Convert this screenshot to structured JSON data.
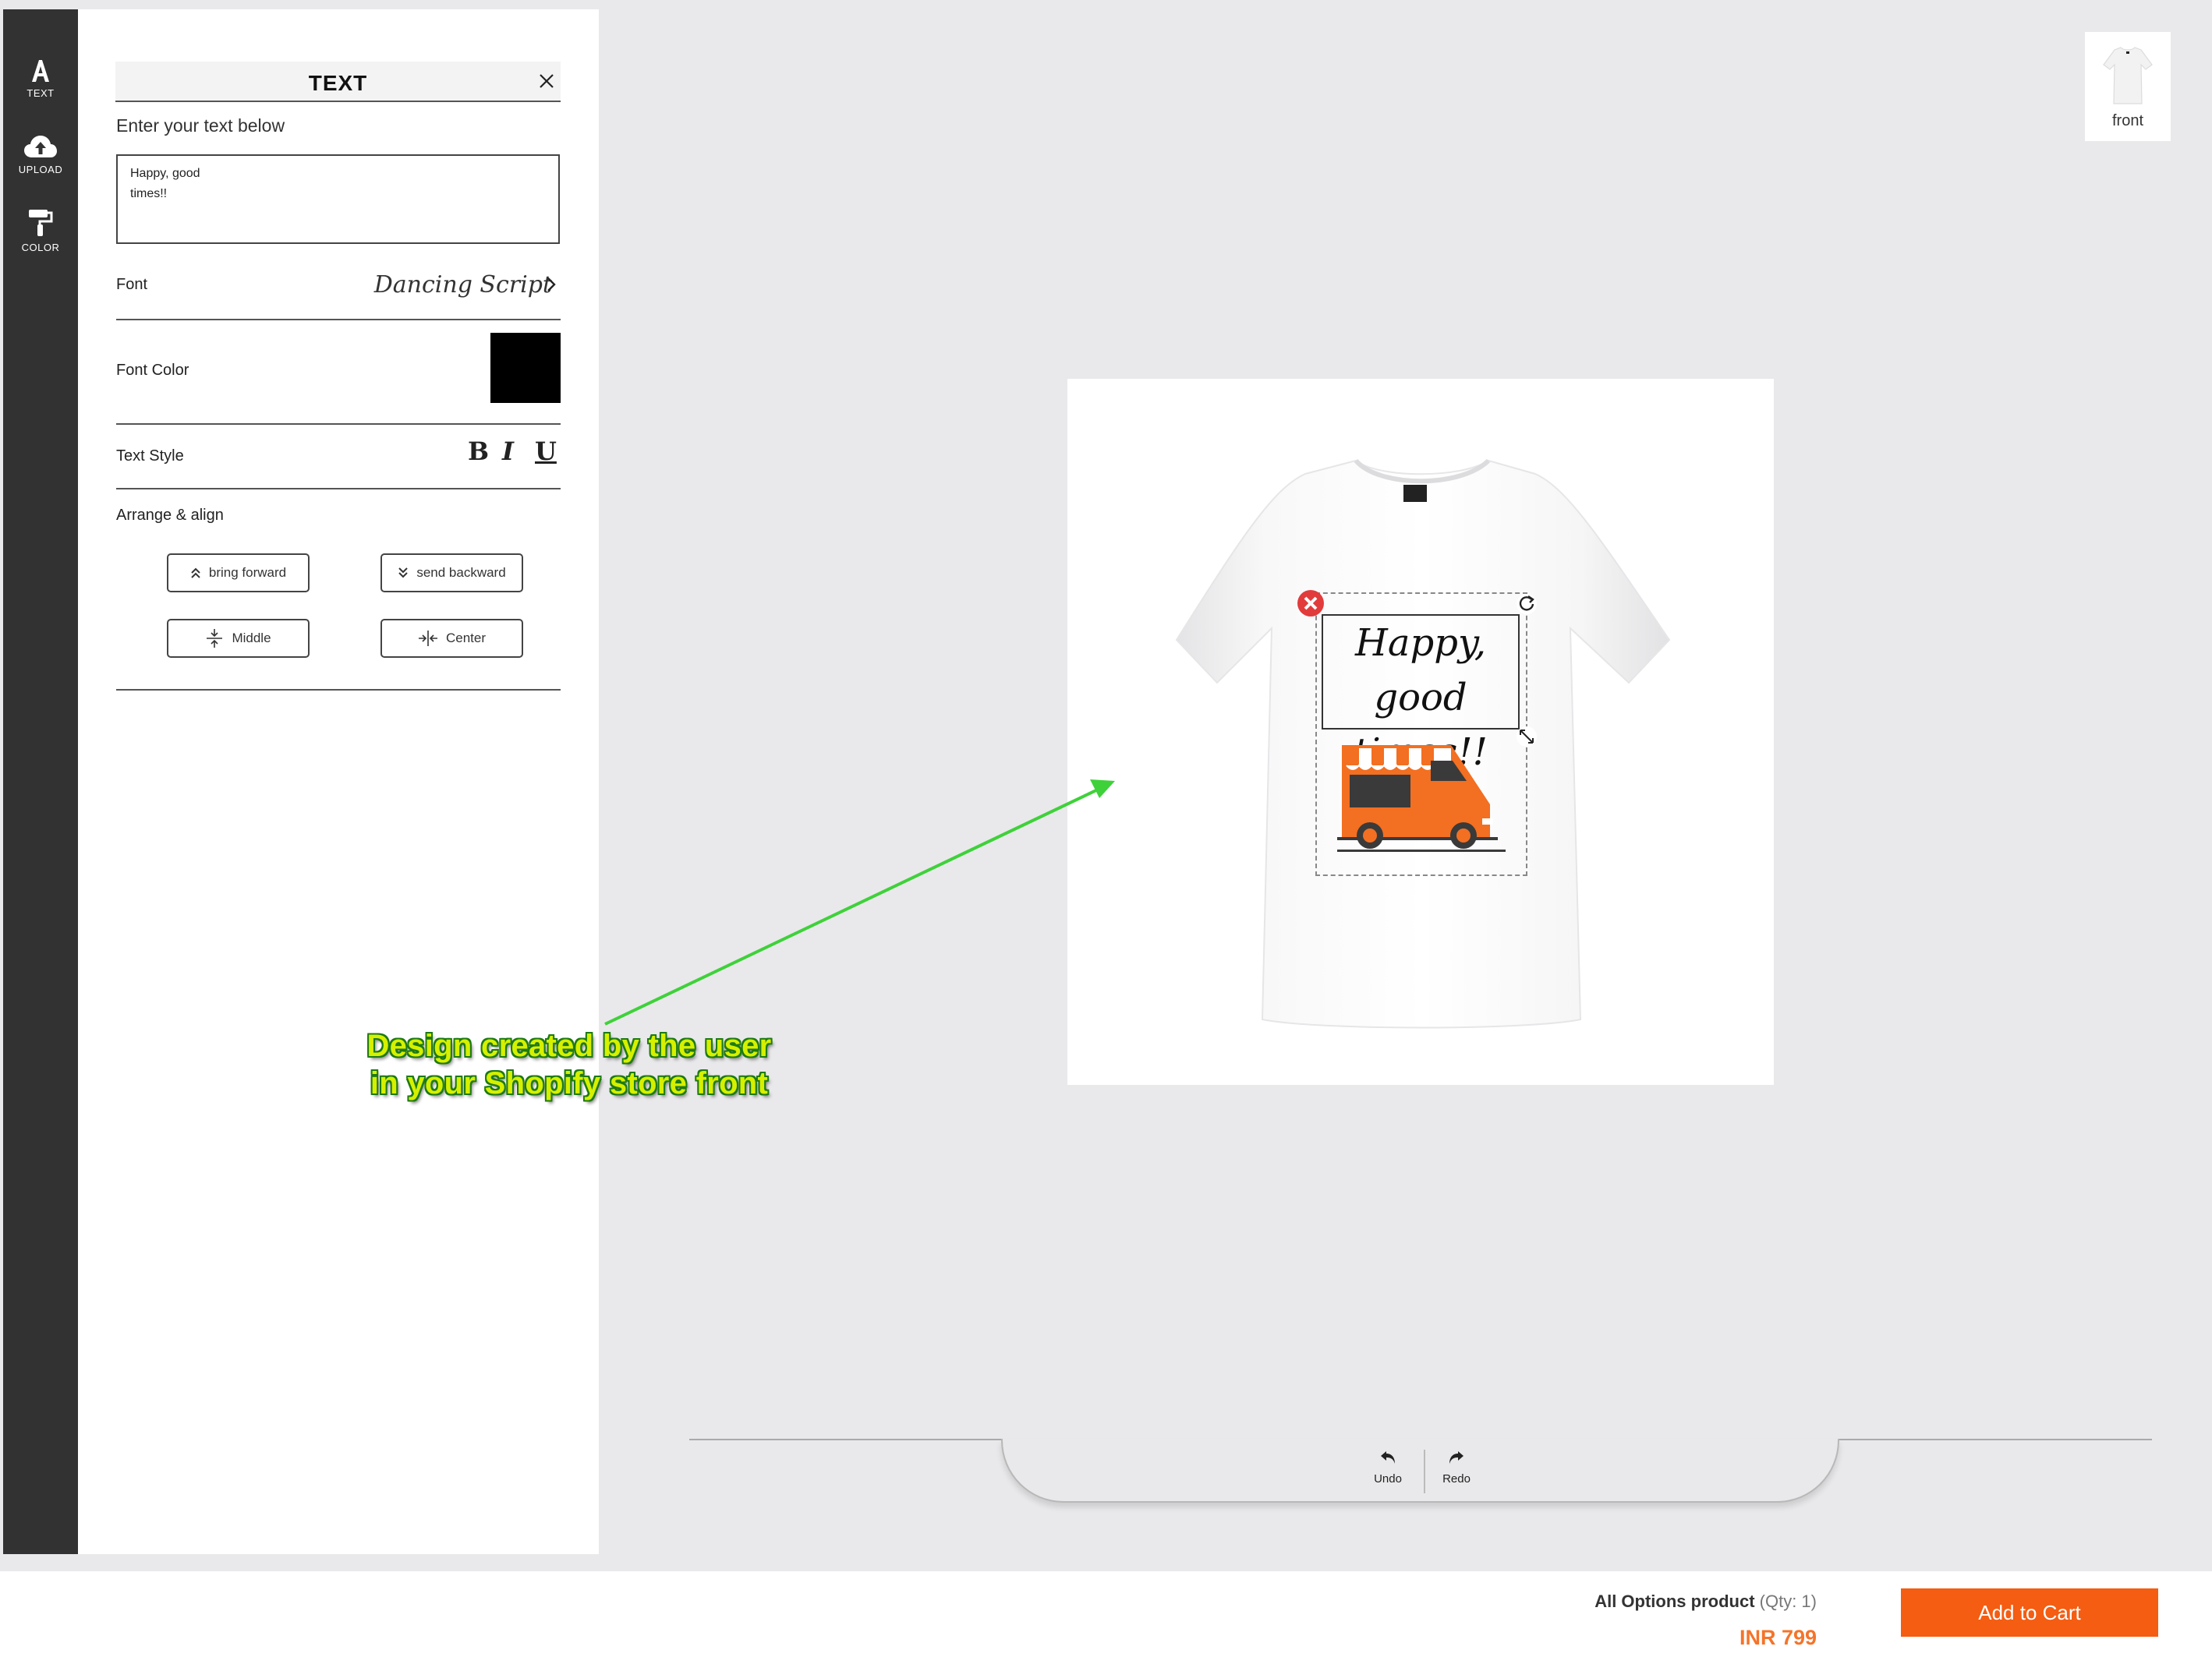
{
  "toolbar": {
    "items": [
      {
        "label": "TEXT",
        "icon": "text-icon"
      },
      {
        "label": "UPLOAD",
        "icon": "cloud-upload-icon"
      },
      {
        "label": "COLOR",
        "icon": "paint-roller-icon"
      }
    ]
  },
  "panel": {
    "title": "TEXT",
    "prompt": "Enter your text below",
    "text_value": "Happy, good\ntimes!!",
    "font_label": "Font",
    "font_value": "Dancing Script",
    "font_color_label": "Font Color",
    "font_color": "#000000",
    "text_style_label": "Text Style",
    "style_buttons": {
      "bold": "B",
      "italic": "I",
      "underline": "U"
    },
    "arrange_label": "Arrange & align",
    "arrange_buttons": {
      "bring_forward": "bring forward",
      "send_backward": "send backward",
      "middle": "Middle",
      "center": "Center"
    }
  },
  "canvas": {
    "design_text": "Happy, good times!!",
    "design_image": "food-truck-van",
    "product_color": "#ffffff"
  },
  "annotation": {
    "line1": "Design created by the user",
    "line2": "in your Shopify store front"
  },
  "views": [
    {
      "label": "front"
    }
  ],
  "history": {
    "undo": "Undo",
    "redo": "Redo"
  },
  "footer": {
    "product_name": "All Options product",
    "qty_text": "(Qty: 1)",
    "price": "INR 799",
    "add_to_cart": "Add to Cart"
  },
  "colors": {
    "accent": "#f45d12",
    "price": "#f4742a",
    "toolbar_bg": "#323232",
    "van_orange": "#f36f21",
    "annotation_fill": "#d6f000",
    "annotation_outline": "#1d7a14"
  }
}
